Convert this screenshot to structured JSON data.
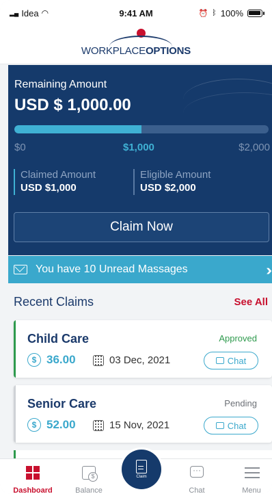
{
  "status_bar": {
    "carrier": "Idea",
    "time": "9:41 AM",
    "battery": "100%",
    "battery_level": 1.0
  },
  "header": {
    "logo_light": "WORKPLACE",
    "logo_bold": "OPTIONS"
  },
  "hero": {
    "remaining_label": "Remaining Amount",
    "remaining_value": "USD $ 1,000.00",
    "progress_fraction": 0.5,
    "scale_min": "$0",
    "scale_mid": "$1,000",
    "scale_max": "$2,000",
    "claimed_label": "Claimed Amount",
    "claimed_value": "USD $1,000",
    "eligible_label": "Eligible Amount",
    "eligible_value": "USD $2,000",
    "claim_button": "Claim Now"
  },
  "messages": {
    "text": "You have 10 Unread Massages",
    "icon": "envelope-icon"
  },
  "recent": {
    "title": "Recent Claims",
    "see_all": "See All",
    "claims": [
      {
        "name": "Child Care",
        "status": "Approved",
        "status_color": "#2e9a4d",
        "amount": "36.00",
        "date": "03 Dec, 2021",
        "chat": "Chat"
      },
      {
        "name": "Senior Care",
        "status": "Pending",
        "status_color": "#6b6f75",
        "amount": "52.00",
        "date": "15 Nov, 2021",
        "chat": "Chat"
      }
    ]
  },
  "nav": {
    "dashboard": "Dashboard",
    "balance": "Balance",
    "claim": "Claim",
    "chat": "Chat",
    "menu": "Menu"
  },
  "colors": {
    "brand_navy": "#153a6b",
    "accent_cyan": "#3aa8cc",
    "brand_red": "#c8102e"
  }
}
